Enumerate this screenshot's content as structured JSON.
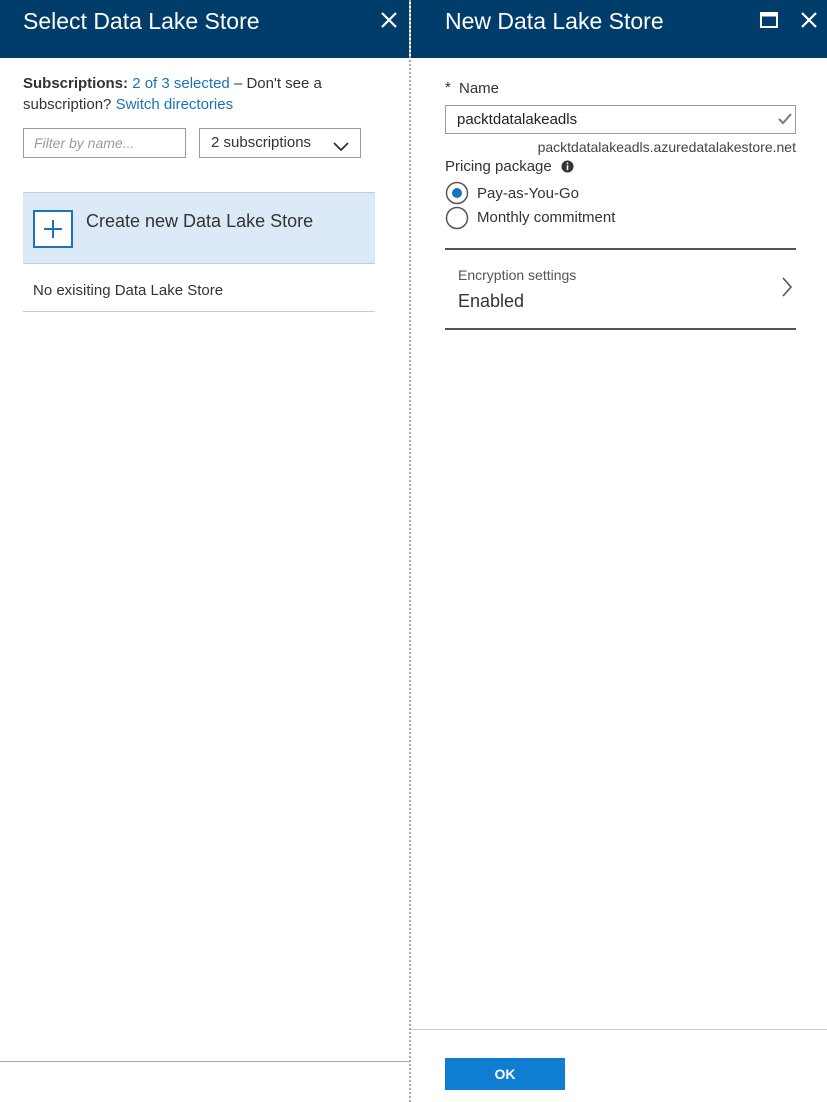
{
  "left_blade": {
    "title": "Select Data Lake Store",
    "subscriptions_label": "Subscriptions:",
    "subscriptions_selected": "2 of 3 selected",
    "subscriptions_hint": "– Don't see a subscription?",
    "switch_directories": "Switch directories",
    "filter": {
      "placeholder": "Filter by name...",
      "value": ""
    },
    "subscription_dropdown": {
      "selected": "2 subscriptions"
    },
    "create_new_label": "Create new Data Lake Store",
    "empty_message": "No exisiting Data Lake Store"
  },
  "right_blade": {
    "title": "New Data Lake Store",
    "name_field": {
      "required_marker": "*",
      "label": "Name",
      "value": "packtdatalakeadls",
      "url_hint": "packtdatalakeadls.azuredatalakestore.net"
    },
    "pricing": {
      "label": "Pricing package",
      "options": [
        {
          "label": "Pay-as-You-Go",
          "selected": true
        },
        {
          "label": "Monthly commitment",
          "selected": false
        }
      ]
    },
    "encryption": {
      "title": "Encryption settings",
      "value": "Enabled"
    },
    "ok_label": "OK"
  },
  "colors": {
    "header_bg": "#003d6b",
    "accent": "#1a73b8",
    "selected_row_bg": "#dbeaf6",
    "ok_button_bg": "#0f7dd2"
  },
  "icons": [
    "close-icon",
    "maximize-icon",
    "chevron-down-icon",
    "plus-icon",
    "checkmark-icon",
    "info-icon",
    "chevron-right-icon"
  ]
}
